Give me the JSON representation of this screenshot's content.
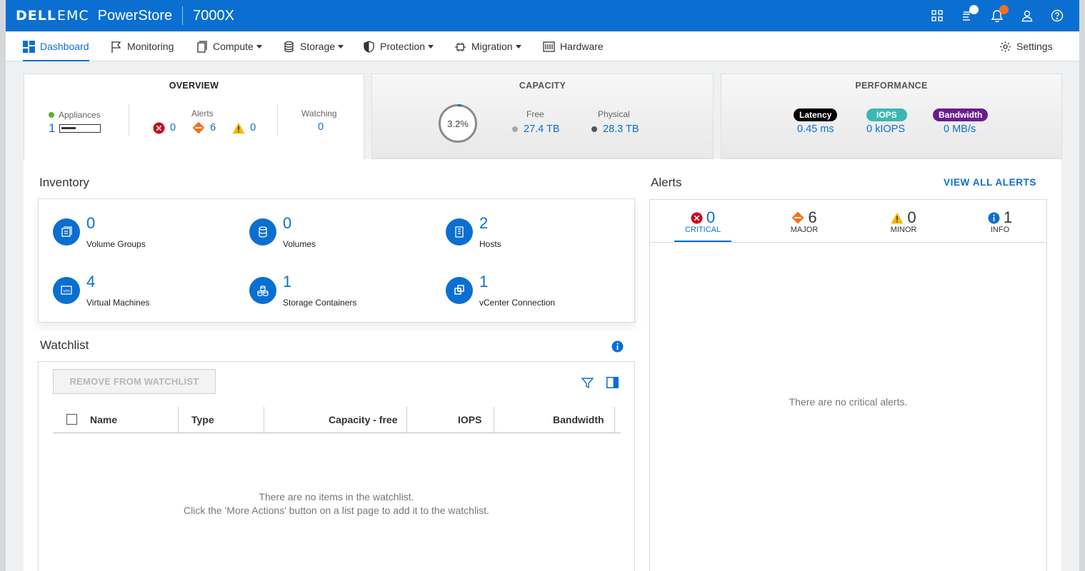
{
  "header": {
    "brand_dell": "DELL",
    "brand_emc": "EMC",
    "product": "PowerStore",
    "model": "7000X"
  },
  "nav": {
    "dashboard": "Dashboard",
    "monitoring": "Monitoring",
    "compute": "Compute",
    "storage": "Storage",
    "protection": "Protection",
    "migration": "Migration",
    "hardware": "Hardware",
    "settings": "Settings"
  },
  "overview": {
    "title": "OVERVIEW",
    "appliances_label": "Appliances",
    "appliances_count": "1",
    "alerts_label": "Alerts",
    "critical": "0",
    "major": "6",
    "minor": "0",
    "watching_label": "Watching",
    "watching_count": "0"
  },
  "capacity": {
    "title": "CAPACITY",
    "percent_text": "3.2%",
    "percent_value": 3.2,
    "free_label": "Free",
    "free_value": "27.4 TB",
    "physical_label": "Physical",
    "physical_value": "28.3 TB"
  },
  "performance": {
    "title": "PERFORMANCE",
    "latency_label": "Latency",
    "latency_value": "0.45 ms",
    "iops_label": "IOPS",
    "iops_value": "0 kIOPS",
    "bandwidth_label": "Bandwidth",
    "bandwidth_value": "0 MB/s"
  },
  "inventory": {
    "title": "Inventory",
    "items": [
      {
        "count": "0",
        "label": "Volume Groups"
      },
      {
        "count": "0",
        "label": "Volumes"
      },
      {
        "count": "2",
        "label": "Hosts"
      },
      {
        "count": "4",
        "label": "Virtual Machines"
      },
      {
        "count": "1",
        "label": "Storage Containers"
      },
      {
        "count": "1",
        "label": "vCenter Connection"
      }
    ]
  },
  "watchlist": {
    "title": "Watchlist",
    "remove_button": "REMOVE FROM WATCHLIST",
    "columns": [
      "Name",
      "Type",
      "Capacity - free",
      "IOPS",
      "Bandwidth"
    ],
    "empty_line1": "There are no items in the watchlist.",
    "empty_line2": "Click the 'More Actions' button on a list page to add it to the watchlist."
  },
  "alerts": {
    "title": "Alerts",
    "view_all": "VIEW ALL ALERTS",
    "tabs": [
      {
        "count": "0",
        "label": "CRITICAL"
      },
      {
        "count": "6",
        "label": "MAJOR"
      },
      {
        "count": "0",
        "label": "MINOR"
      },
      {
        "count": "1",
        "label": "INFO"
      }
    ],
    "empty_text": "There are no critical alerts."
  },
  "colors": {
    "brand_blue": "#0a6fd1",
    "critical": "#d0021b",
    "major": "#f2711c",
    "minor": "#f5b800",
    "info": "#0a6fd1",
    "latency_pill": "#000000",
    "iops_pill": "#3bb8b4",
    "bandwidth_pill": "#6a1b8f"
  }
}
